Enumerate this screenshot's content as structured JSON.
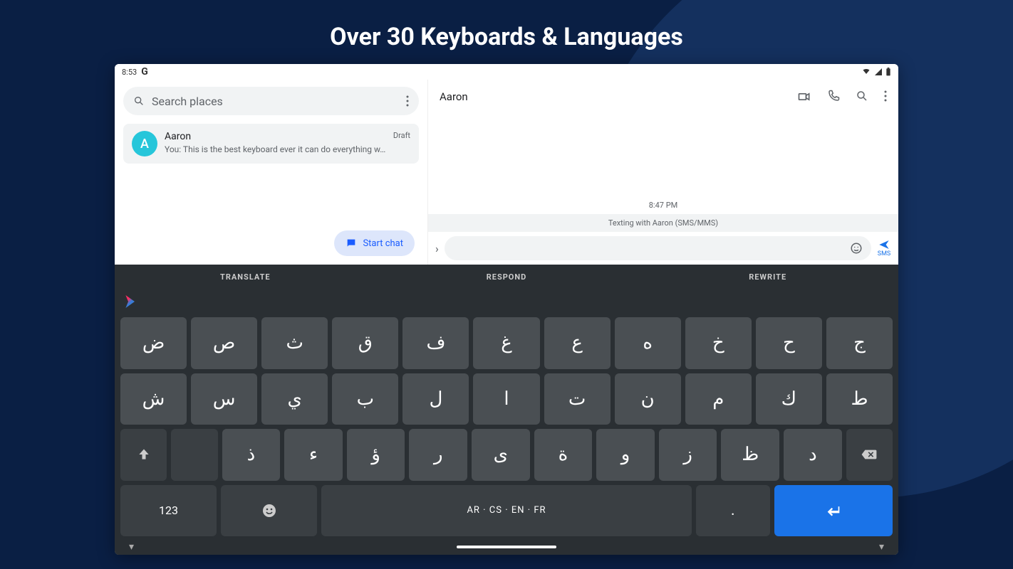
{
  "headline": "Over 30 Keyboards & Languages",
  "status": {
    "time": "8:53",
    "g": "G"
  },
  "left": {
    "search_placeholder": "Search places",
    "convo": {
      "avatar_letter": "A",
      "name": "Aaron",
      "tag": "Draft",
      "preview": "You: This is the best keyboard ever it can do everything w…"
    },
    "start_chat": "Start chat"
  },
  "right": {
    "title": "Aaron",
    "timestamp": "8:47 PM",
    "texting_with": "Texting with Aaron (SMS/MMS)",
    "sms": "SMS"
  },
  "keyboard": {
    "tabs": [
      "TRANSLATE",
      "RESPOND",
      "REWRITE"
    ],
    "row1": [
      "ض",
      "ص",
      "ث",
      "ق",
      "ف",
      "غ",
      "ع",
      "ه",
      "خ",
      "ح",
      "ج"
    ],
    "row2": [
      "ش",
      "س",
      "ي",
      "ب",
      "ل",
      "ا",
      "ت",
      "ن",
      "م",
      "ك",
      "ط"
    ],
    "row3": [
      "ذ",
      "ء",
      "ؤ",
      "ر",
      "ى",
      "ة",
      "و",
      "ز",
      "ظ",
      "د"
    ],
    "numsym": "123",
    "space_label": "AR · CS · EN · FR",
    "period": "."
  }
}
